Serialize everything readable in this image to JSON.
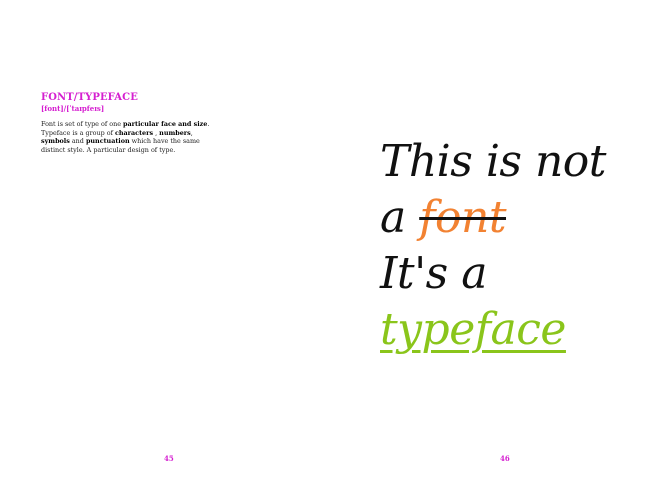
{
  "left_page": {
    "term": "FONT/TYPEFACE",
    "pronunciation": "[font]/[ˈtaɪpfeɪs]",
    "definition": {
      "p1": "Font is set of type of one ",
      "b1": "particular face and size",
      "p2": ". Typeface is a group of ",
      "b2": "characters",
      "p3": " , ",
      "b3": "numbers",
      "p4": ", ",
      "b4": "symbols",
      "p5": " and ",
      "b5": "punctuation",
      "p6": " which have the same distinct style. A particular design of type."
    },
    "page_number": "45"
  },
  "right_page": {
    "line1": "This is not",
    "line2_prefix": "a ",
    "line2_struck": "font",
    "line3": "It's a",
    "line4": "typeface ",
    "page_number": "46"
  },
  "colors": {
    "accent_magenta": "#d51fd0",
    "font_orange": "#f28232",
    "typeface_green": "#8ac51b"
  }
}
